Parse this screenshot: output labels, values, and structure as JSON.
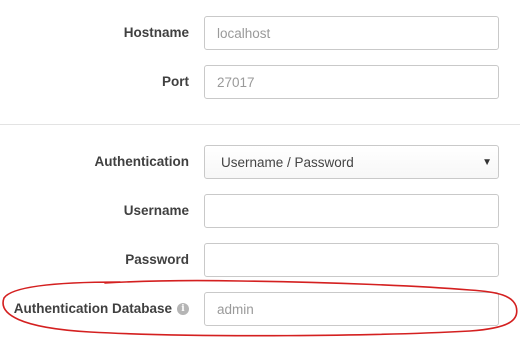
{
  "connection": {
    "hostname": {
      "label": "Hostname",
      "placeholder": "localhost"
    },
    "port": {
      "label": "Port",
      "placeholder": "27017"
    }
  },
  "auth": {
    "method": {
      "label": "Authentication",
      "selected": "Username / Password",
      "caret_icon": "caret-down-icon"
    },
    "username": {
      "label": "Username",
      "value": ""
    },
    "password": {
      "label": "Password",
      "value": ""
    },
    "database": {
      "label": "Authentication Database",
      "info_icon": "info-icon",
      "info_glyph": "i",
      "placeholder": "admin"
    }
  },
  "annotation_color": "#d42020"
}
